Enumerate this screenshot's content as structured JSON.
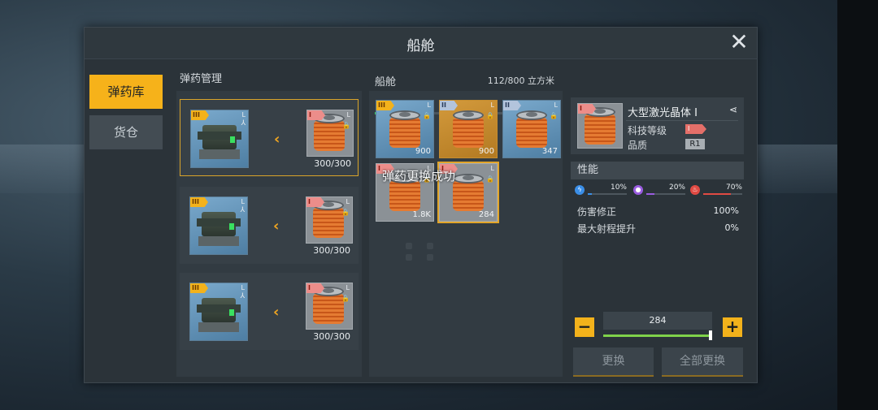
{
  "window": {
    "title": "船舱",
    "close_icon": "close-icon"
  },
  "tabs": [
    {
      "label": "弹药库",
      "active": true
    },
    {
      "label": "货仓",
      "active": false
    }
  ],
  "ammo_management": {
    "title": "弹药管理",
    "slots": [
      {
        "weapon_tier": "III",
        "weapon_size": "L",
        "ammo_tier": "I",
        "ammo_size": "L",
        "ammo_count": "300/300",
        "selected": true
      },
      {
        "weapon_tier": "III",
        "weapon_size": "L",
        "ammo_tier": "I",
        "ammo_size": "L",
        "ammo_count": "300/300",
        "selected": false
      },
      {
        "weapon_tier": "III",
        "weapon_size": "L",
        "ammo_tier": "I",
        "ammo_size": "L",
        "ammo_count": "300/300",
        "selected": false
      }
    ]
  },
  "cargo": {
    "title": "船舱",
    "capacity": "112/800 立方米",
    "capacity_fraction": 0.14,
    "items": [
      {
        "tier": "III",
        "size": "L",
        "count": "900",
        "style": "blue"
      },
      {
        "tier": "II",
        "size": "L",
        "count": "900",
        "style": "orange"
      },
      {
        "tier": "II",
        "size": "L",
        "count": "347",
        "style": "blue"
      },
      {
        "tier": "I",
        "size": "L",
        "count": "1.8K",
        "style": "gray"
      },
      {
        "tier": "I",
        "size": "L",
        "count": "284",
        "style": "gray",
        "selected": true
      }
    ],
    "toast": "弹药更换成功"
  },
  "detail": {
    "name": "大型激光晶体 I",
    "tech_label": "科技等级",
    "tech_value": "I",
    "quality_label": "品质",
    "quality_value": "R1",
    "performance_title": "性能",
    "stats": [
      {
        "icon": "lightning-icon",
        "value": "10%",
        "fraction": 0.1,
        "color": "#3b8fe8"
      },
      {
        "icon": "orb-icon",
        "value": "20%",
        "fraction": 0.2,
        "color": "#9a5ce0"
      },
      {
        "icon": "fire-icon",
        "value": "70%",
        "fraction": 0.7,
        "color": "#e04a43"
      }
    ],
    "props": [
      {
        "label": "伤害修正",
        "value": "100%"
      },
      {
        "label": "最大射程提升",
        "value": "0%"
      }
    ]
  },
  "quantity": {
    "value": "284",
    "fraction": 1.0,
    "minus": "−",
    "plus": "+"
  },
  "buttons": {
    "replace": "更换",
    "replace_all": "全部更换"
  }
}
